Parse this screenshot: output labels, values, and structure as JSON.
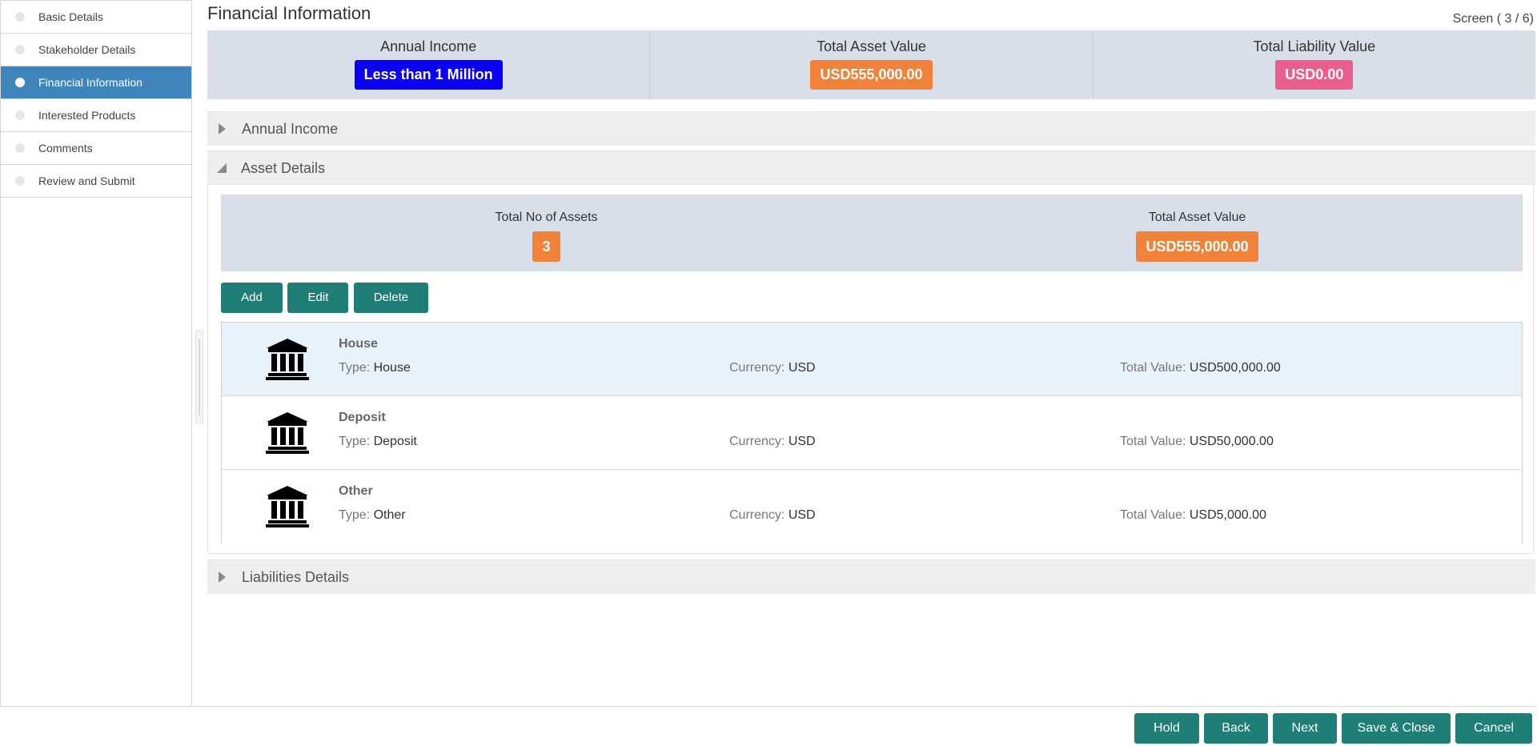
{
  "sidebar": {
    "items": [
      {
        "label": "Basic Details"
      },
      {
        "label": "Stakeholder Details"
      },
      {
        "label": "Financial Information"
      },
      {
        "label": "Interested Products"
      },
      {
        "label": "Comments"
      },
      {
        "label": "Review and Submit"
      }
    ],
    "active_index": 2
  },
  "header": {
    "title": "Financial Information",
    "screen_indicator": "Screen ( 3 / 6)"
  },
  "summary": {
    "annual_income_label": "Annual Income",
    "annual_income_value": "Less than 1 Million",
    "total_asset_label": "Total Asset Value",
    "total_asset_value": "USD555,000.00",
    "total_liability_label": "Total Liability Value",
    "total_liability_value": "USD0.00"
  },
  "sections": {
    "annual_income": "Annual Income",
    "asset_details": "Asset Details",
    "liabilities_details": "Liabilities Details"
  },
  "asset_details": {
    "count_label": "Total No of Assets",
    "count_value": "3",
    "value_label": "Total Asset Value",
    "value_value": "USD555,000.00",
    "buttons": {
      "add": "Add",
      "edit": "Edit",
      "delete": "Delete"
    },
    "field_labels": {
      "type": "Type:",
      "currency": "Currency:",
      "total_value": "Total Value:"
    },
    "assets": [
      {
        "title": "House",
        "type": "House",
        "currency": "USD",
        "total_value": "USD500,000.00"
      },
      {
        "title": "Deposit",
        "type": "Deposit",
        "currency": "USD",
        "total_value": "USD50,000.00"
      },
      {
        "title": "Other",
        "type": "Other",
        "currency": "USD",
        "total_value": "USD5,000.00"
      }
    ]
  },
  "footer": {
    "hold": "Hold",
    "back": "Back",
    "next": "Next",
    "save_close": "Save & Close",
    "cancel": "Cancel"
  },
  "colors": {
    "primary_button": "#1f7f76",
    "active_nav": "#3f84bb",
    "income_badge": "#0a00f5",
    "asset_badge": "#f08239",
    "liability_badge": "#ea5e8e",
    "summary_bg": "#d9dfe9"
  },
  "icons": [
    "bank-icon",
    "caret-right-icon",
    "caret-down-icon"
  ]
}
